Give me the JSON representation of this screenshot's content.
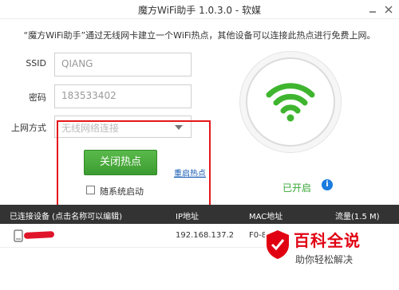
{
  "window": {
    "title": "魔方WiFi助手 1.0.3.0 - 软媒"
  },
  "description": "“魔方WiFi助手”通过无线网卡建立一个WiFi热点，其他设备可以连接此热点进行免费上网。",
  "form": {
    "ssid_label": "SSID",
    "ssid_value": "QIANG",
    "password_label": "密码",
    "password_value": "183533402",
    "method_label": "上网方式",
    "method_value": "无线网络连接",
    "close_hotspot_label": "关闭热点",
    "restart_link": "重启热点",
    "autostart_label": "随系统启动",
    "autostart_checked": false
  },
  "status": {
    "text": "已开启",
    "info_glyph": "i",
    "accent_color": "#35a634"
  },
  "table": {
    "headers": [
      "已连接设备 (点击名称可以编辑)",
      "IP地址",
      "MAC地址",
      "流量(1.5 M)"
    ],
    "rows": [
      {
        "device_icon": "phone-icon",
        "ip": "192.168.137.2",
        "mac": "F0-84-C"
      }
    ]
  },
  "watermark": {
    "title": "百科全说",
    "subtitle": "助你轻松解决"
  }
}
